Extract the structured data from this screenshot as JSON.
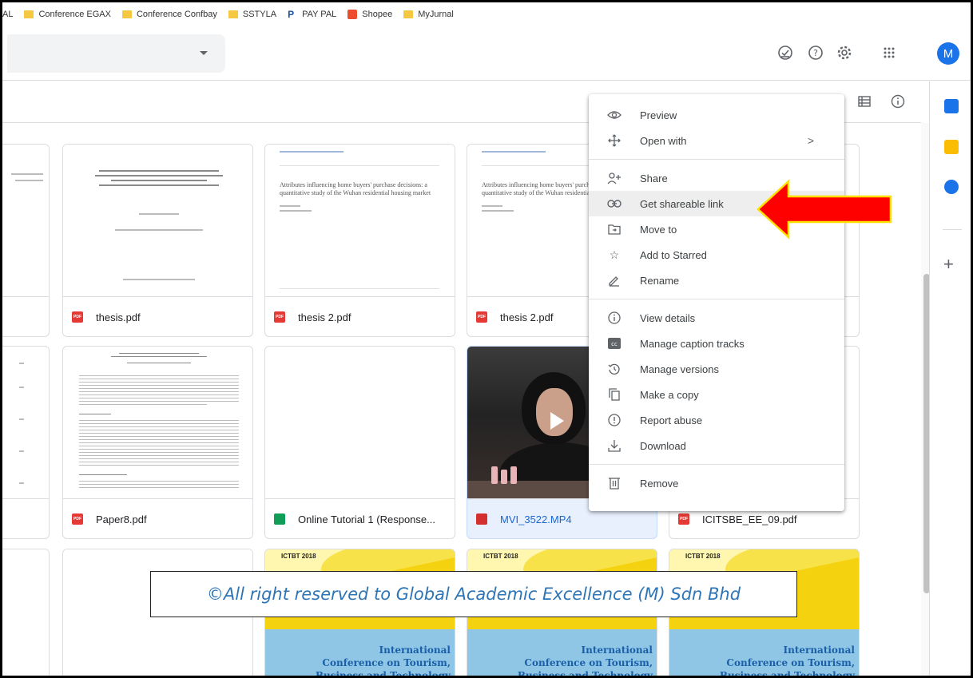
{
  "bookmarks": [
    {
      "label": "AL",
      "icon": "none"
    },
    {
      "label": "Conference EGAX",
      "icon": "folder-icon"
    },
    {
      "label": "Conference Confbay",
      "icon": "folder-icon"
    },
    {
      "label": "SSTYLA",
      "icon": "folder-icon"
    },
    {
      "label": "PAY PAL",
      "icon": "paypal-icon"
    },
    {
      "label": "Shopee",
      "icon": "shopee-icon"
    },
    {
      "label": "MyJurnal",
      "icon": "folder-icon"
    }
  ],
  "header": {
    "avatar_letter": "M",
    "icons": [
      "offline-ready-icon",
      "help-icon",
      "settings-icon",
      "apps-grid-icon"
    ]
  },
  "toolbar": {
    "icons": [
      "list-view-icon",
      "info-icon"
    ]
  },
  "files": [
    {
      "name": "thesis.pdf",
      "type": "pdf"
    },
    {
      "name": "thesis 2.pdf",
      "type": "pdf"
    },
    {
      "name": "thesis 2.pdf",
      "type": "pdf"
    },
    {
      "name": "Paper8.pdf",
      "type": "pdf"
    },
    {
      "name": "Online Tutorial 1 (Response...",
      "type": "sheet"
    },
    {
      "name": "MVI_3522.MP4",
      "type": "video"
    },
    {
      "name": "ICITSBE_EE_09.pdf",
      "type": "pdf"
    }
  ],
  "thumb_text": {
    "doc_heading": "Attributes influencing home buyers' purchase decisions: a quantitative study of the Wuhan residential housing market",
    "conf_tag": "ICTBT 2018",
    "conf_title": "International Conference on Tourism, Business and Technology"
  },
  "context_menu": {
    "items": [
      {
        "label": "Preview",
        "icon": "eye-icon"
      },
      {
        "label": "Open with",
        "icon": "move-arrows-icon",
        "submenu": true
      },
      {
        "label": "Share",
        "icon": "add-person-icon"
      },
      {
        "label": "Get shareable link",
        "icon": "link-icon",
        "highlighted": true
      },
      {
        "label": "Move to",
        "icon": "move-to-folder-icon"
      },
      {
        "label": "Add to Starred",
        "icon": "star-icon"
      },
      {
        "label": "Rename",
        "icon": "pencil-icon"
      },
      {
        "label": "View details",
        "icon": "info-icon"
      },
      {
        "label": "Manage caption tracks",
        "icon": "closed-caption-icon"
      },
      {
        "label": "Manage versions",
        "icon": "history-icon"
      },
      {
        "label": "Make a copy",
        "icon": "copy-icon"
      },
      {
        "label": "Report abuse",
        "icon": "report-icon"
      },
      {
        "label": "Download",
        "icon": "download-icon"
      },
      {
        "label": "Remove",
        "icon": "trash-icon"
      }
    ],
    "submenu_glyph": ">"
  },
  "copyright": "©All right reserved to Global Academic Excellence (M) Sdn Bhd",
  "colors": {
    "accent": "#1a73e8",
    "arrow": "#ff0000",
    "arrow_outline": "#ffe000",
    "copyright_text": "#2e75b6",
    "selection": "#e8f0fe"
  }
}
